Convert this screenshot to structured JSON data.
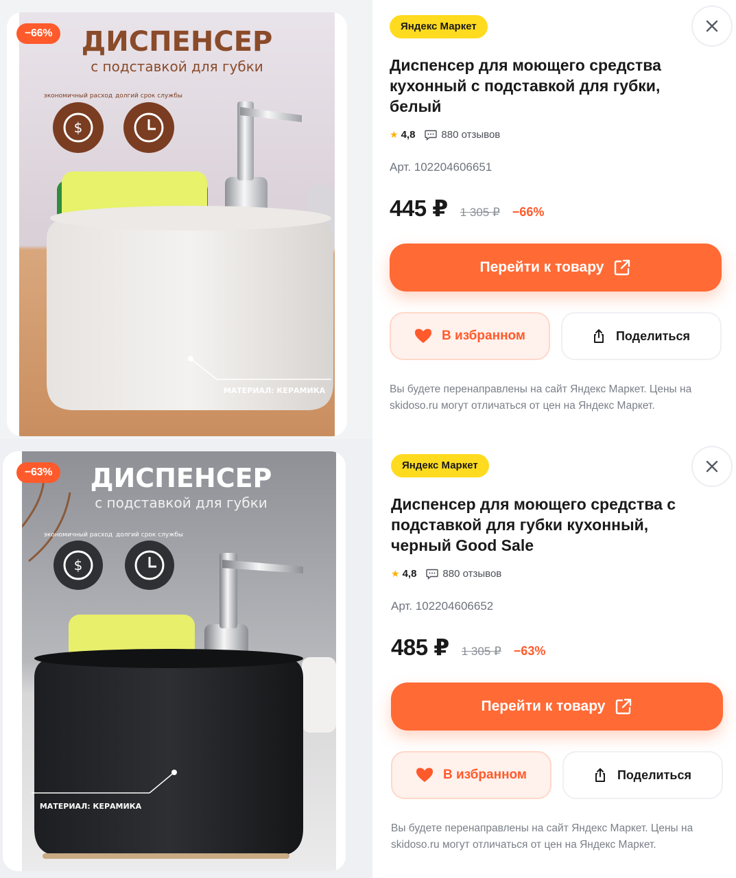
{
  "cards": [
    {
      "discount_badge": "−66%",
      "market_badge": "Яндекс Маркет",
      "title": "Диспенсер для моющего средства кухонный с подставкой для губки, белый",
      "rating": "4,8",
      "reviews": "880 отзывов",
      "article": "Арт. 102204606651",
      "price": "445 ₽",
      "old_price": "1 305 ₽",
      "discount_pct": "−66%",
      "go_button": "Перейти к товару",
      "fav_button": "В избранном",
      "share_button": "Поделиться",
      "note": "Вы будете перенаправлены на сайт Яндекс Маркет. Цены на skidoso.ru могут отличаться от цен на Яндекс Маркет.",
      "image": {
        "headline": "ДИСПЕНСЕР",
        "subline": "с подставкой для губки",
        "icon1_caption": "экономичный расход",
        "icon2_caption": "долгий срок службы",
        "material": "МАТЕРИАЛ: КЕРАМИКА"
      }
    },
    {
      "discount_badge": "−63%",
      "market_badge": "Яндекс Маркет",
      "title": "Диспенсер для моющего средства с подставкой для губки кухонный, черный Good Sale",
      "rating": "4,8",
      "reviews": "880 отзывов",
      "article": "Арт. 102204606652",
      "price": "485 ₽",
      "old_price": "1 305 ₽",
      "discount_pct": "−63%",
      "go_button": "Перейти к товару",
      "fav_button": "В избранном",
      "share_button": "Поделиться",
      "note": "Вы будете перенаправлены на сайт Яндекс Маркет. Цены на skidoso.ru могут отличаться от цен на Яндекс Маркет.",
      "image": {
        "headline": "ДИСПЕНСЕР",
        "subline": "с подставкой для губки",
        "icon1_caption": "экономичный расход",
        "icon2_caption": "долгий срок службы",
        "material": "МАТЕРИАЛ: КЕРАМИКА"
      }
    }
  ],
  "colors": {
    "accent": "#ff6a35",
    "discount": "#ff5a2b",
    "market_yellow": "#ffdb1f",
    "star": "#ffb000"
  }
}
